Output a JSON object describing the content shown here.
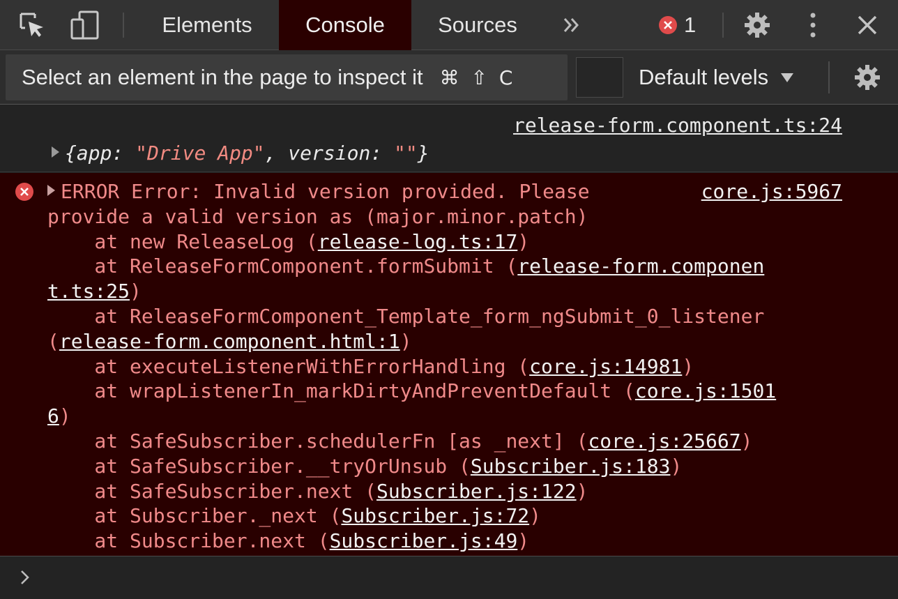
{
  "tabs": [
    {
      "label": "Elements",
      "active": false
    },
    {
      "label": "Console",
      "active": true
    },
    {
      "label": "Sources",
      "active": false
    }
  ],
  "toolbar": {
    "more_tabs_icon": "double-chevron-right",
    "error_count": "1",
    "settings_icon": "gear",
    "menu_icon": "vertical-ellipsis",
    "close_icon": "close"
  },
  "filterbar": {
    "inspect_tip": "Select an element in the page to inspect it",
    "shortcut": "⌘ ⇧ C",
    "levels_label": "Default levels"
  },
  "console": {
    "log": {
      "source": "release-form.component.ts:24",
      "object_prefix": "{app: ",
      "app_value": "\"Drive App\"",
      "object_mid": ", version: ",
      "version_value": "\"\"",
      "object_suffix": "}"
    },
    "error": {
      "source": "core.js:5967",
      "line1": "ERROR Error: Invalid version provided. Please",
      "line2": "provide a valid version as (major.minor.patch)",
      "stack": [
        {
          "text": "    at new ReleaseLog (",
          "link": "release-log.ts:17",
          "tail": ")"
        },
        {
          "text": "    at ReleaseFormComponent.formSubmit (",
          "link": "release-form.componen",
          "tail": ""
        },
        {
          "text": "",
          "link": "t.ts:25",
          "tail": ")"
        },
        {
          "text": "    at ReleaseFormComponent_Template_form_ngSubmit_0_listener",
          "link": "",
          "tail": ""
        },
        {
          "text": "(",
          "link": "release-form.component.html:1",
          "tail": ")"
        },
        {
          "text": "    at executeListenerWithErrorHandling (",
          "link": "core.js:14981",
          "tail": ")"
        },
        {
          "text": "    at wrapListenerIn_markDirtyAndPreventDefault (",
          "link": "core.js:1501",
          "tail": ""
        },
        {
          "text": "",
          "link": "6",
          "tail": ")"
        },
        {
          "text": "    at SafeSubscriber.schedulerFn [as _next] (",
          "link": "core.js:25667",
          "tail": ")"
        },
        {
          "text": "    at SafeSubscriber.__tryOrUnsub (",
          "link": "Subscriber.js:183",
          "tail": ")"
        },
        {
          "text": "    at SafeSubscriber.next (",
          "link": "Subscriber.js:122",
          "tail": ")"
        },
        {
          "text": "    at Subscriber._next (",
          "link": "Subscriber.js:72",
          "tail": ")"
        },
        {
          "text": "    at Subscriber.next (",
          "link": "Subscriber.js:49",
          "tail": ")"
        }
      ]
    }
  },
  "colors": {
    "error_red": "#e04b4b",
    "error_text": "#f08a8a",
    "error_bg": "#290000"
  }
}
